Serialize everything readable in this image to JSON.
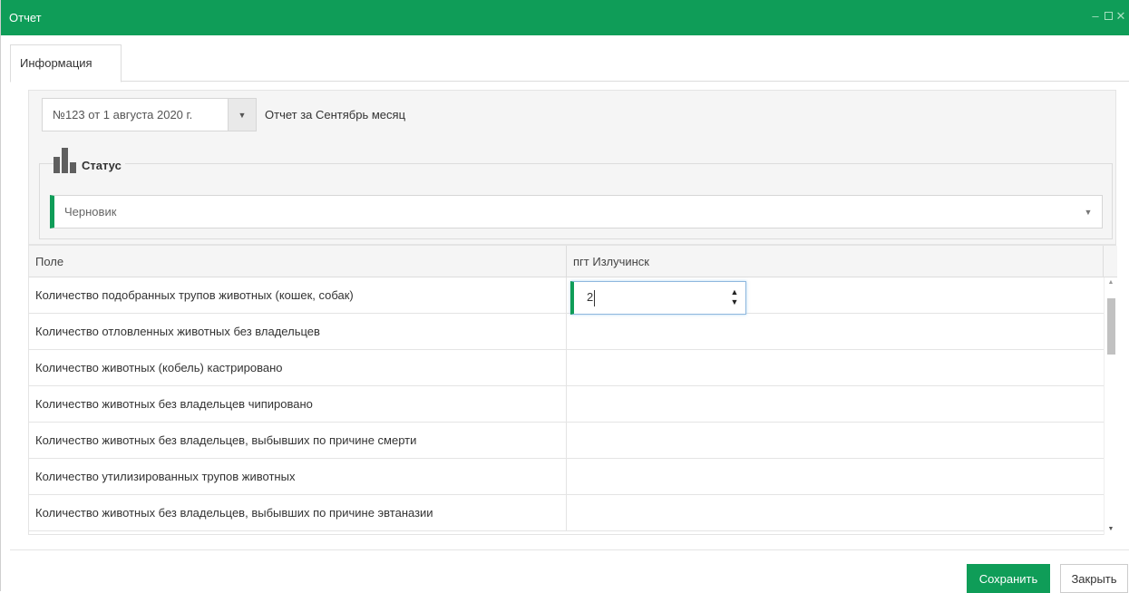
{
  "window": {
    "title": "Отчет",
    "controls": [
      "minimize-icon",
      "maximize-icon",
      "close-icon"
    ]
  },
  "tabs": [
    {
      "label": "Информация",
      "active": true
    }
  ],
  "report": {
    "selected": "№123 от 1 августа 2020 г.",
    "label": "Отчет за Сентябрь месяц"
  },
  "status": {
    "legend": "Статус",
    "icon": "bar-chart-icon",
    "selected": "Черновик"
  },
  "grid": {
    "columns": [
      "Поле",
      "пгт Излучинск"
    ],
    "rows": [
      {
        "field": "Количество подобранных трупов животных (кошек, собак)",
        "value": "2"
      },
      {
        "field": "Количество отловленных животных без владельцев",
        "value": ""
      },
      {
        "field": "Количество животных (кобель) кастрировано",
        "value": ""
      },
      {
        "field": "Количество животных без владельцев чипировано",
        "value": ""
      },
      {
        "field": "Количество животных без владельцев, выбывших по причине смерти",
        "value": ""
      },
      {
        "field": "Количество утилизированных трупов животных",
        "value": ""
      },
      {
        "field": "Количество животных без владельцев, выбывших по причине эвтаназии",
        "value": ""
      }
    ]
  },
  "buttons": {
    "save": "Сохранить",
    "close": "Закрыть"
  },
  "colors": {
    "accent": "#0f9d58"
  }
}
